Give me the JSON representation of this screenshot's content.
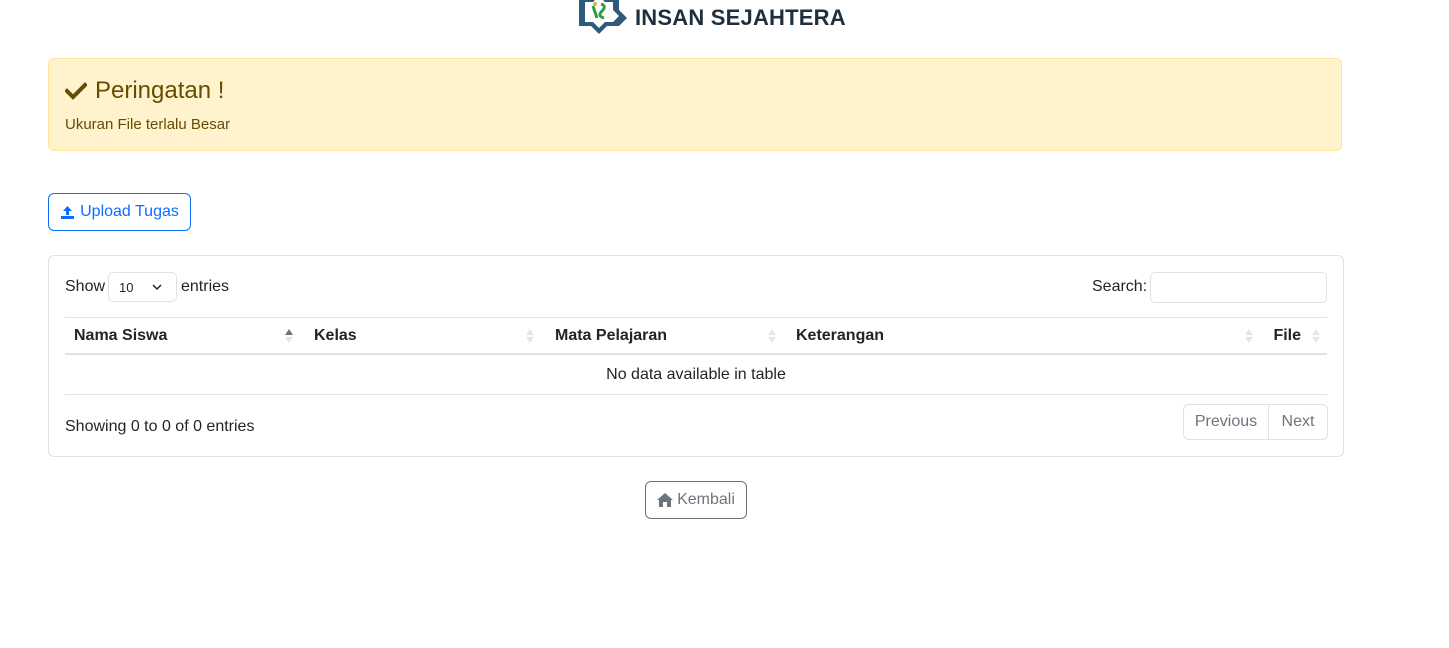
{
  "header": {
    "school_name": "INSAN SEJAHTERA",
    "logo_icon": "school-logo-icon"
  },
  "alert": {
    "title": "Peringatan !",
    "message": "Ukuran File terlalu Besar",
    "icon": "check-icon",
    "colors": {
      "background": "#fff3cd",
      "border": "#ffe69c",
      "text": "#664d03"
    }
  },
  "upload_button": {
    "label": "Upload Tugas",
    "icon": "upload-icon",
    "color": "#0d6efd"
  },
  "table_controls": {
    "show_label": "Show",
    "length_value": "10",
    "entries_label": "entries",
    "search_label": "Search:",
    "search_value": ""
  },
  "table": {
    "columns": [
      "Nama Siswa",
      "Kelas",
      "Mata Pelajaran",
      "Keterangan",
      "File"
    ],
    "sorted_column": "Nama Siswa",
    "sort_direction": "ascending",
    "empty_message": "No data available in table"
  },
  "footer": {
    "info": "Showing 0 to 0 of 0 entries",
    "previous_label": "Previous",
    "next_label": "Next"
  },
  "back_button": {
    "label": "Kembali",
    "icon": "home-icon"
  }
}
